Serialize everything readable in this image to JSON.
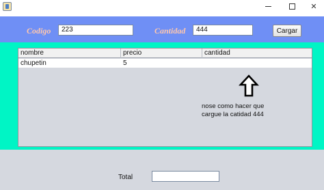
{
  "window": {
    "title": "",
    "minimize_glyph": "—",
    "maximize_glyph": "☐",
    "close_glyph": "✕"
  },
  "form": {
    "codigo_label": "Codigo",
    "codigo_value": "223",
    "cantidad_label": "Cantidad",
    "cantidad_value": "444",
    "cargar_button": "Cargar"
  },
  "table": {
    "columns": [
      "nombre",
      "precio",
      "cantidad"
    ],
    "rows": [
      {
        "nombre": "chupetin",
        "precio": "5",
        "cantidad": ""
      }
    ]
  },
  "annotation": {
    "icon": "arrow-up-icon",
    "line1": "nose como hacer que",
    "line2": "cargue la catidad 444"
  },
  "footer": {
    "total_label": "Total",
    "total_value": ""
  },
  "colors": {
    "top_panel": "#6f8ff5",
    "label_color": "#ffc7ad",
    "teal_panel": "#00f5c5",
    "table_bg": "#d5d8df"
  }
}
